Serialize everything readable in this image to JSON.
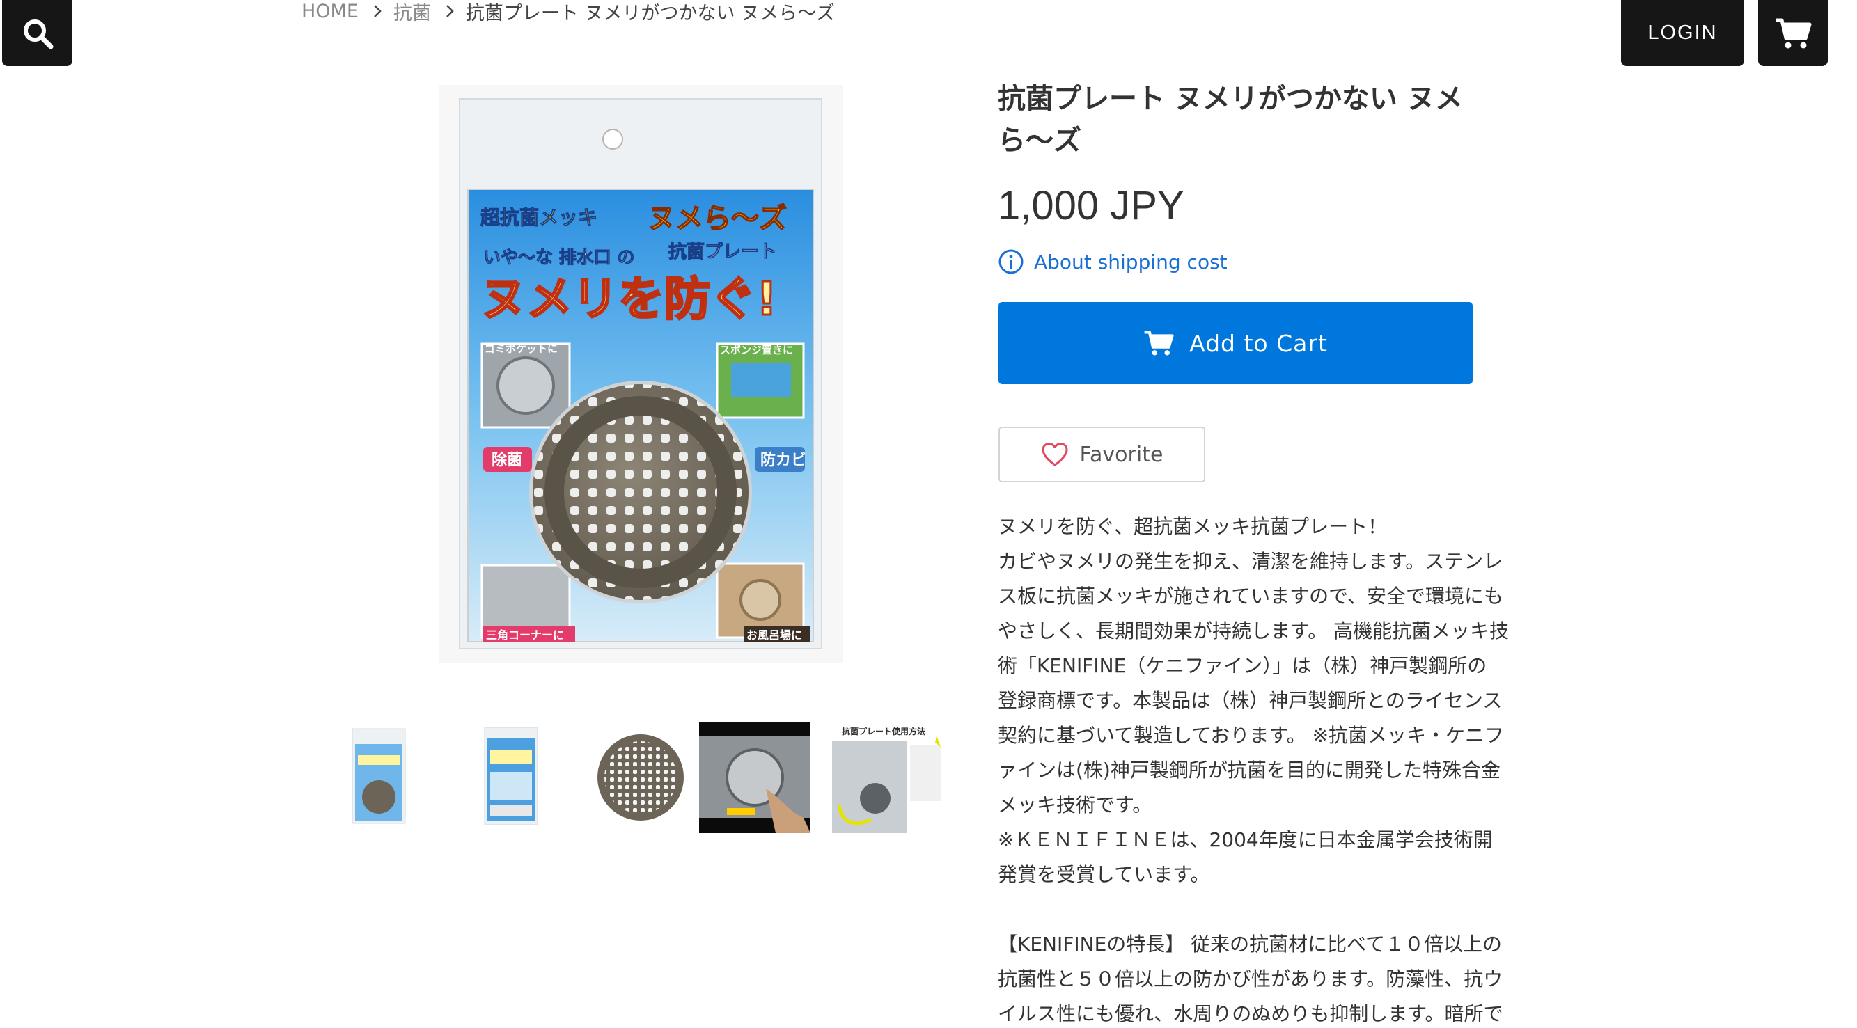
{
  "header": {
    "login_label": "LOGIN",
    "search_icon": "search-icon",
    "cart_icon": "cart-icon"
  },
  "breadcrumb": {
    "items": [
      "HOME",
      "抗菌",
      "抗菌プレート ヌメリがつかない ヌメら〜ズ"
    ]
  },
  "product": {
    "title": "抗菌プレート ヌメリがつかない ヌメら〜ズ",
    "price": "1,000 JPY",
    "shipping_label": "About shipping cost",
    "add_to_cart_label": "Add to Cart",
    "favorite_label": "Favorite",
    "package_text": {
      "top_left": "超抗菌メッキ",
      "brand": "ヌメら〜ズ",
      "brand_sub": "抗菌プレート",
      "tagline": "いや〜な 排水口 の",
      "headline": "ヌメリを防ぐ!",
      "label_pocket": "ゴミポケットに",
      "label_sponge": "スポンジ置きに",
      "label_jokin": "除菌",
      "label_bokabi": "防カビ",
      "label_corner": "三角コーナーに",
      "label_bath": "お風呂場に"
    },
    "thumbnail_caption": "抗菌プレート使用方法"
  },
  "description": {
    "paragraph1": [
      "ヌメリを防ぐ、超抗菌メッキ抗菌プレート！",
      "カビやヌメリの発生を抑え、清潔を維持します。ステンレ",
      "ス板に抗菌メッキが施されていますので、安全で環境にも",
      "やさしく、長期間効果が持続します。 高機能抗菌メッキ技",
      "術「KENIFINE（ケニファイン）」は（株）神戸製鋼所の",
      "登録商標です。本製品は（株）神戸製鋼所とのライセンス",
      "契約に基づいて製造しております。 ※抗菌メッキ・ケニフ",
      "ァインは(株)神戸製鋼所が抗菌を目的に開発した特殊合金",
      "メッキ技術です。",
      "※ＫＥＮＩＦＩＮＥは、2004年度に日本金属学会技術開",
      "発賞を受賞しています。"
    ],
    "paragraph2": [
      "【KENIFINEの特長】 従来の抗菌材に比べて１０倍以上の",
      "抗菌性と５０倍以上の防かび性があります。防藻性、抗ウ",
      "イルス性にも優れ、水周りのぬめりも抑制します。暗所で"
    ]
  },
  "colors": {
    "accent": "#0077dd",
    "dark": "#161616",
    "link": "#1a6fd4",
    "heart": "#e04a5f"
  }
}
